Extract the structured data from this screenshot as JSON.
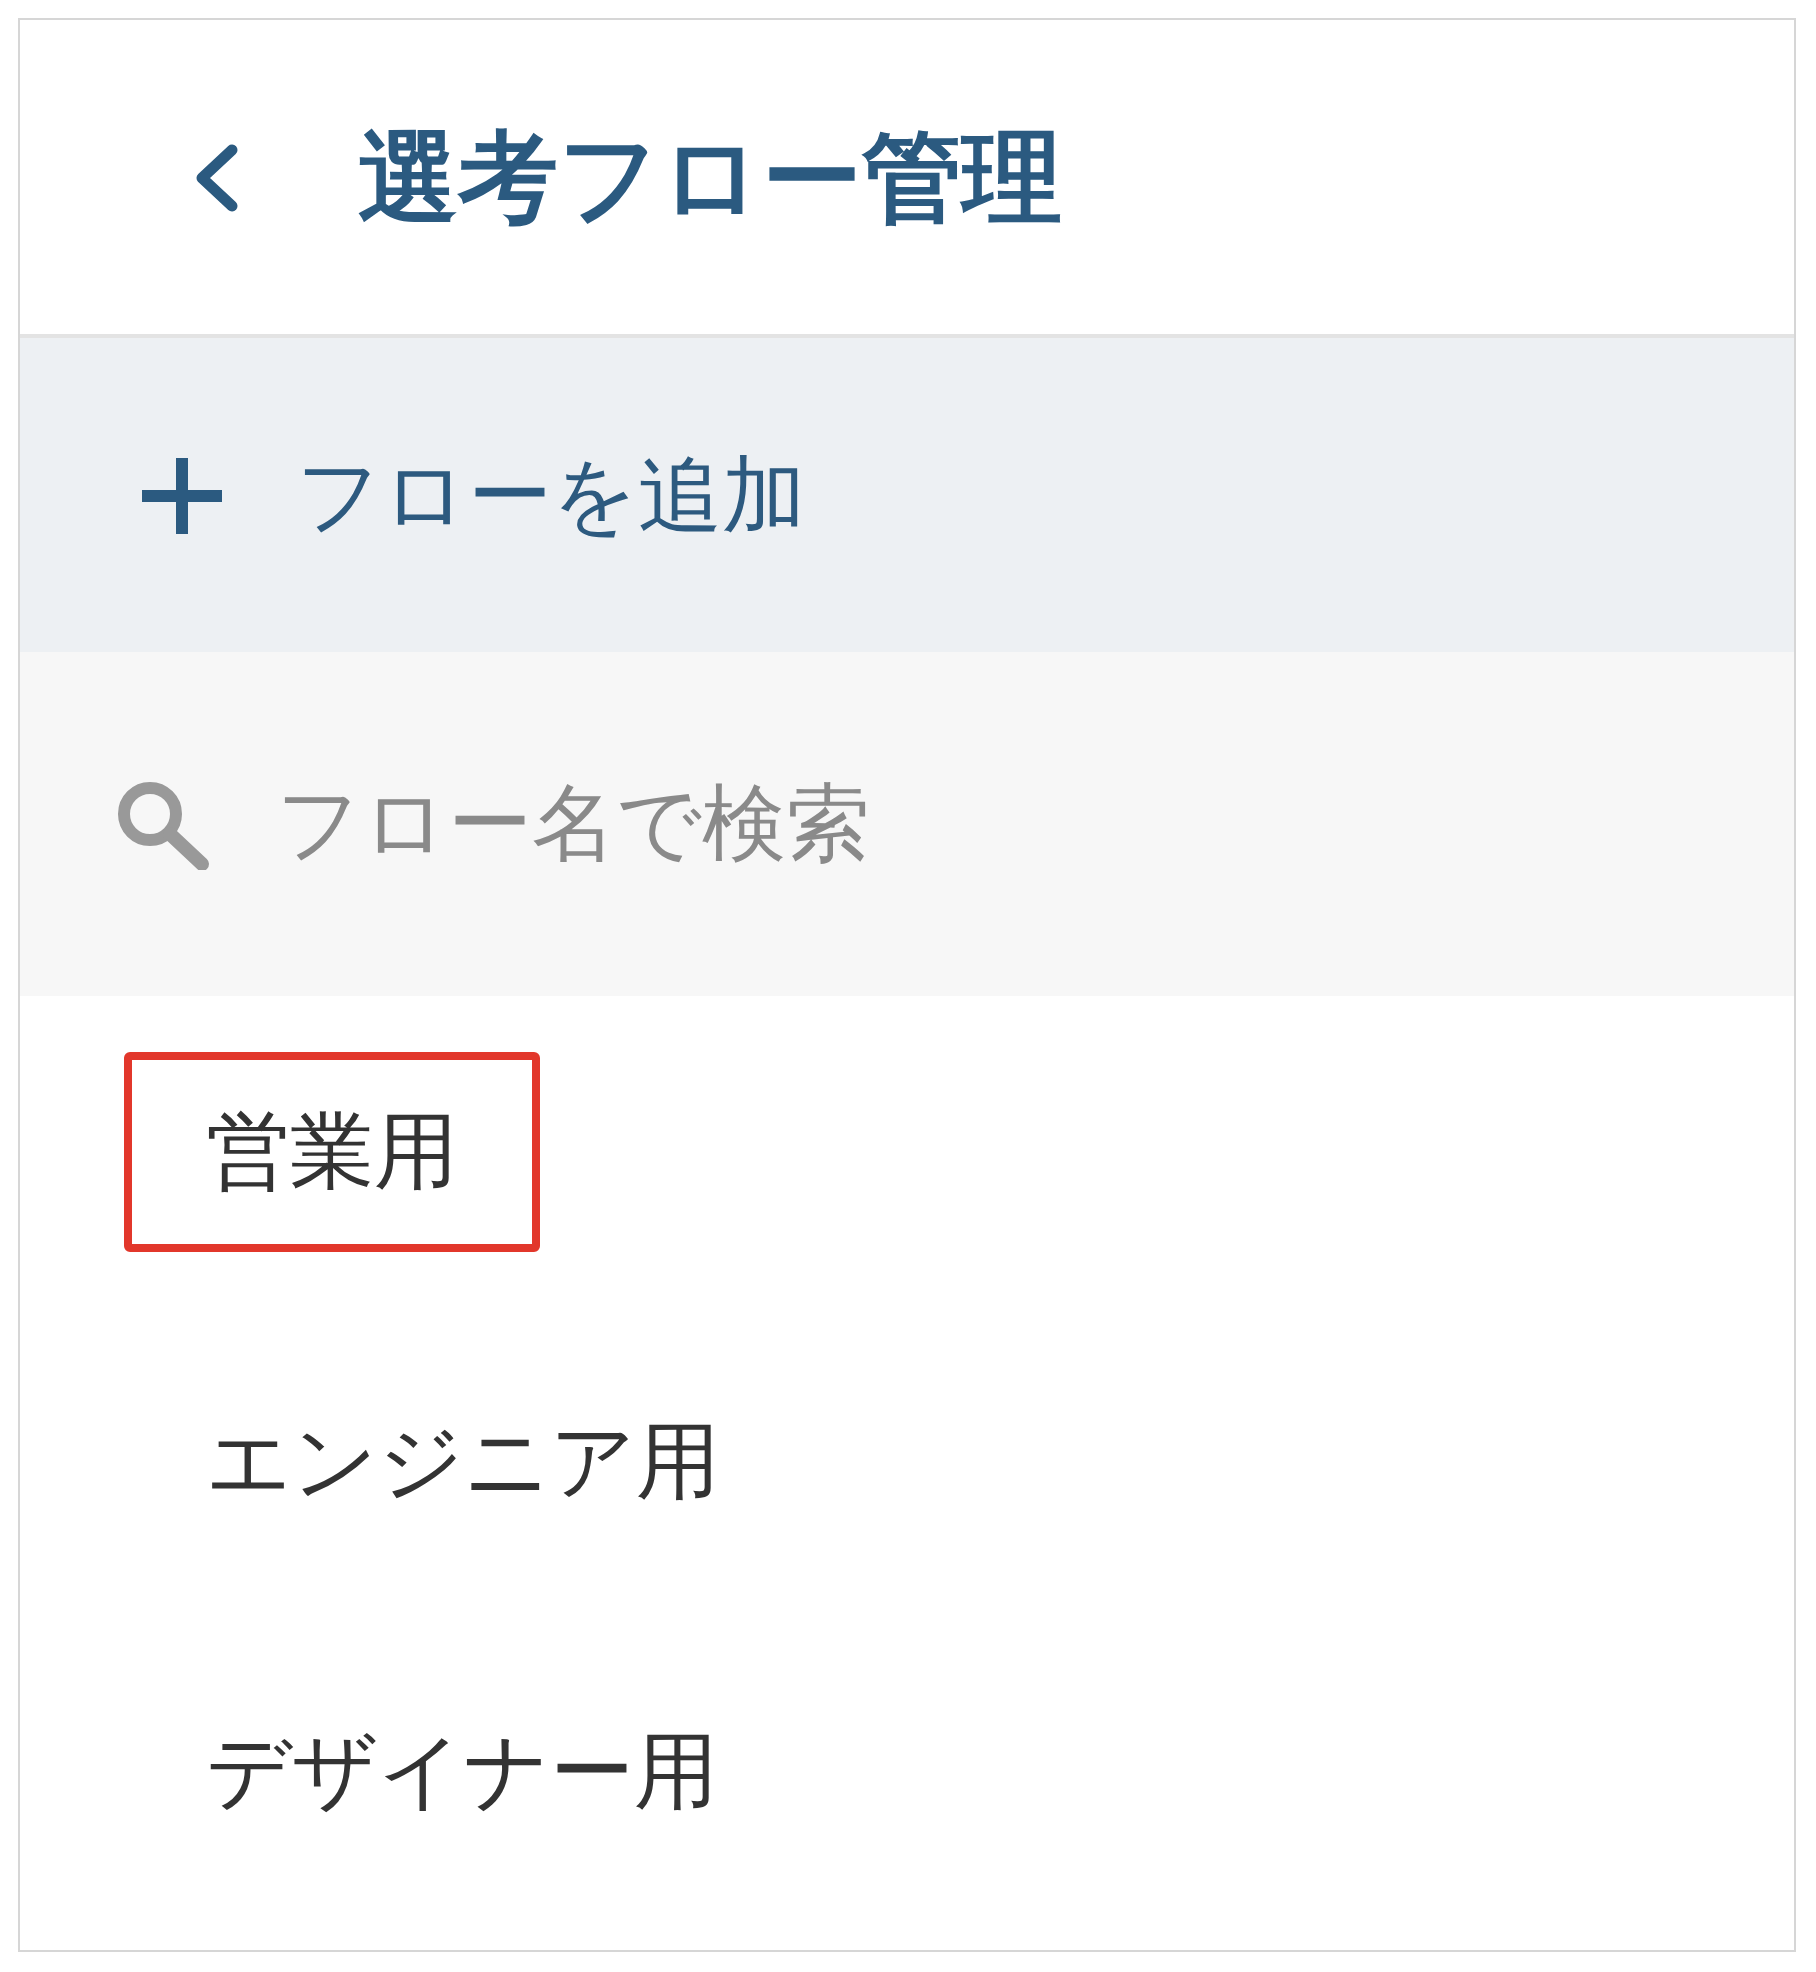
{
  "header": {
    "title": "選考フロー管理"
  },
  "add_button": {
    "label": "フローを追加"
  },
  "search": {
    "placeholder": "フロー名で検索"
  },
  "flows": [
    {
      "name": "営業用",
      "highlighted": true
    },
    {
      "name": "エンジニア用",
      "highlighted": false
    },
    {
      "name": "デザイナー用",
      "highlighted": false
    }
  ]
}
